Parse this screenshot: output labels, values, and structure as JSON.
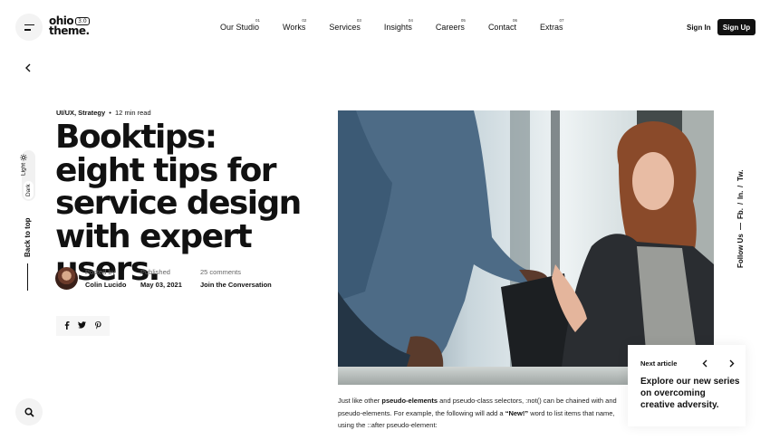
{
  "header": {
    "logo_text_1": "ohio",
    "logo_badge": "3.0",
    "logo_text_2": "theme.",
    "nav": [
      {
        "num": "01",
        "label": "Our Studio"
      },
      {
        "num": "02",
        "label": "Works"
      },
      {
        "num": "03",
        "label": "Services"
      },
      {
        "num": "04",
        "label": "Insights"
      },
      {
        "num": "05",
        "label": "Careers"
      },
      {
        "num": "06",
        "label": "Contact"
      },
      {
        "num": "07",
        "label": "Extras"
      }
    ],
    "signin_label": "Sign In",
    "signup_label": "Sign Up"
  },
  "sidebar": {
    "theme_light": "Light",
    "theme_dark": "Dark",
    "back_to_top": "Back to top"
  },
  "article": {
    "categories": "UI/UX, Strategy",
    "separator": "•",
    "read_time": "12 min read",
    "title": "Booktips: eight tips for service design with expert users.",
    "posted_by_label": "Posted by",
    "author": "Colin Lucido",
    "published_label": "Published",
    "date": "May 03, 2021",
    "comments_label": "25 comments",
    "comments_link": "Join the Conversation",
    "share": {
      "facebook": "f",
      "twitter": "t",
      "pinterest": "p"
    },
    "body_1": "Just like other ",
    "body_bold_1": "pseudo-elements",
    "body_2": " and pseudo-class selectors, :not() can be chained with and pseudo-elements. For example, the following will add a ",
    "body_bold_2": "“New!”",
    "body_3": " word to list items that name, using the ::after pseudo-element:"
  },
  "follow": {
    "label": "Follow Us",
    "dash": "—",
    "links": [
      "Fb.",
      "In.",
      "Tw."
    ],
    "sep": "/"
  },
  "next_article": {
    "label": "Next article",
    "title": "Explore our new series on overcoming creative adversity."
  },
  "colors": {
    "accent": "#111111",
    "background": "#ffffff",
    "muted": "#f3f3f3"
  },
  "icons": {
    "menu": "hamburger-icon",
    "back": "chevron-left-icon",
    "light": "sun-icon",
    "search": "search-icon"
  }
}
